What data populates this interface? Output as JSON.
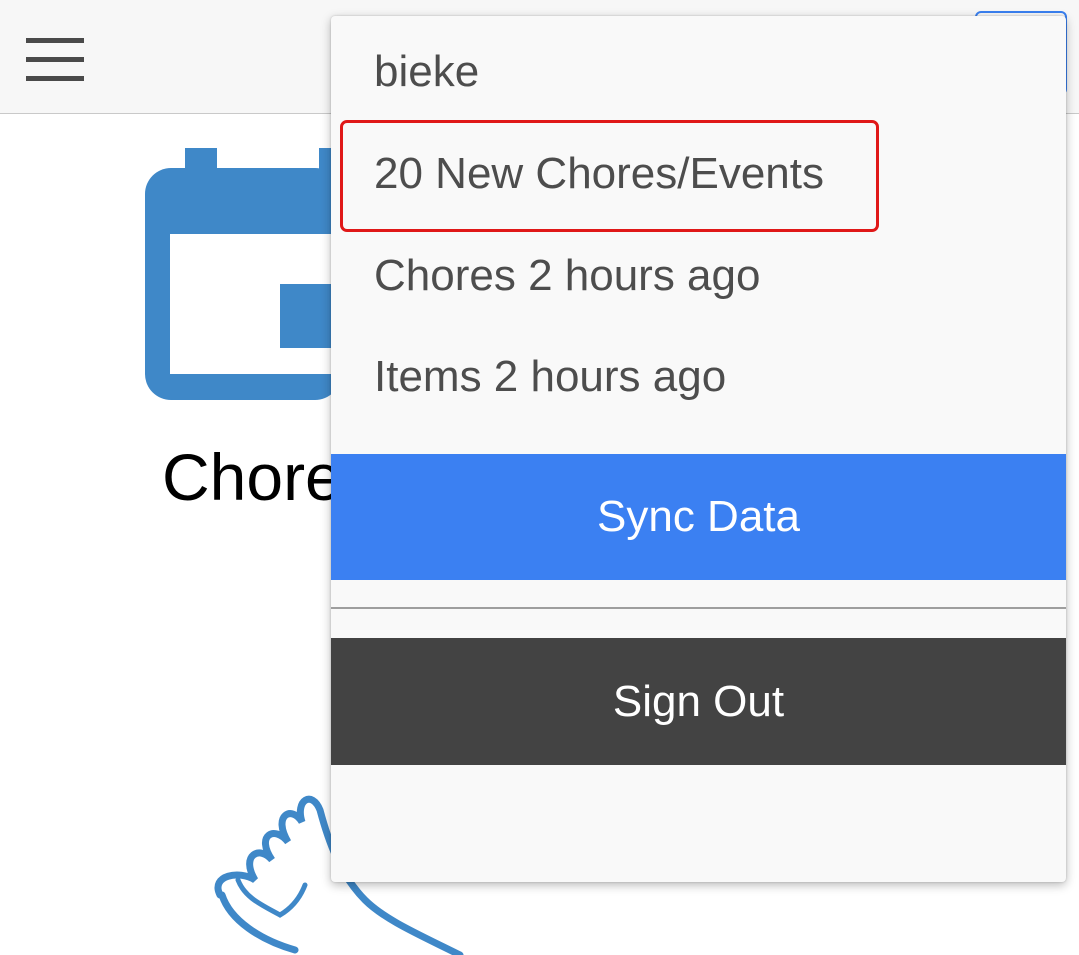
{
  "header": {
    "menu_icon": "hamburger-menu-icon",
    "user_button_icon": "user-menu-button"
  },
  "main": {
    "tile_icon": "calendar-icon",
    "tile_title": "Chores",
    "decoration_icon": "hand-doodle-icon",
    "accent_color": "#3f88c8"
  },
  "dropdown": {
    "username": "bieke",
    "items": [
      {
        "label": "20 New Chores/Events",
        "highlighted": true
      },
      {
        "label": "Chores 2 hours ago"
      },
      {
        "label": "Items 2 hours ago"
      }
    ],
    "sync_label": "Sync Data",
    "sign_out_label": "Sign Out",
    "highlight_color": "#e01818",
    "sync_color": "#3b80f2",
    "sign_out_color": "#434343"
  }
}
